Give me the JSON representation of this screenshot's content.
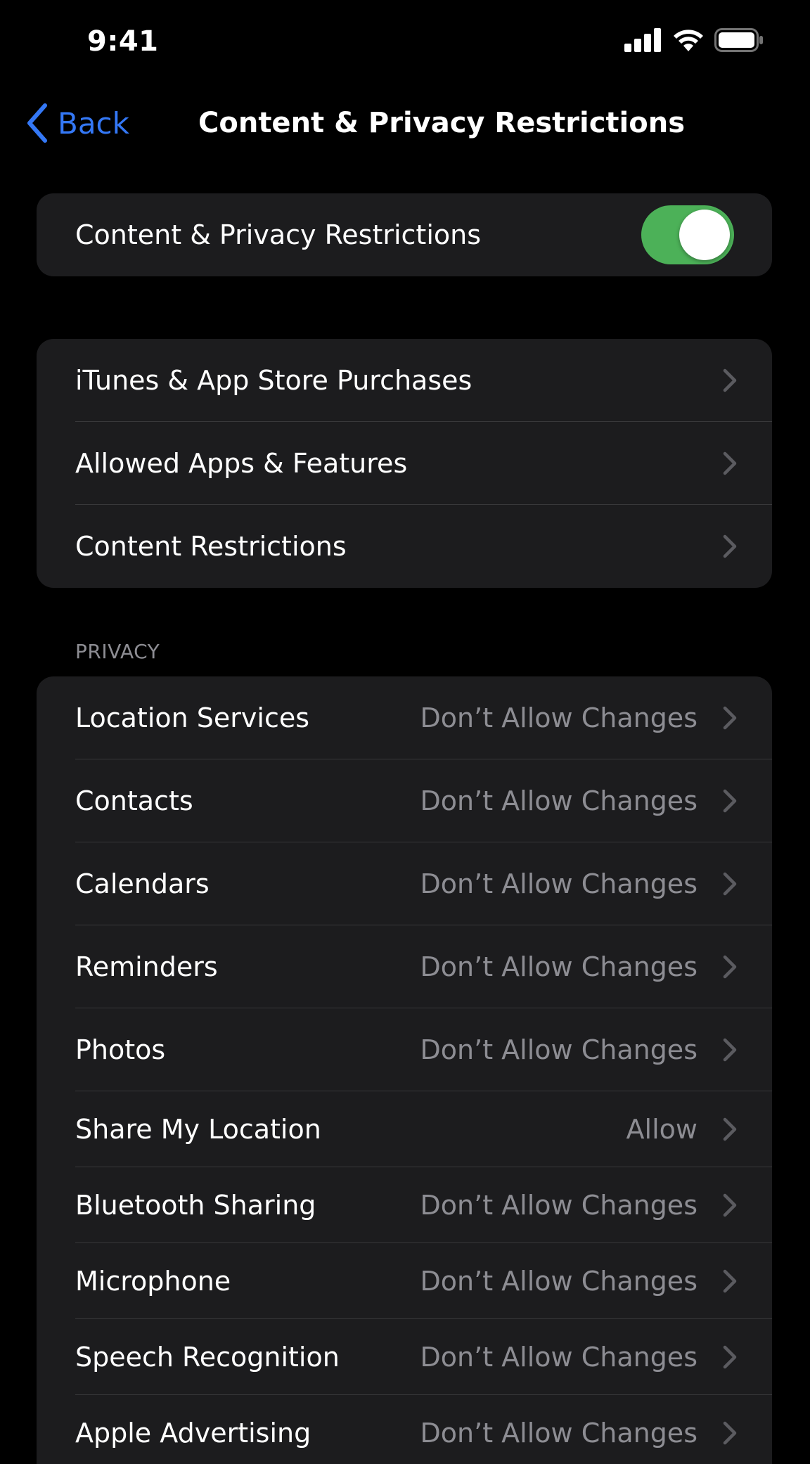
{
  "status_bar": {
    "time": "9:41",
    "icons": [
      "cellular-signal-icon",
      "wifi-icon",
      "battery-icon"
    ]
  },
  "nav": {
    "back_label": "Back",
    "title": "Content & Privacy Restrictions"
  },
  "main_toggle": {
    "label": "Content & Privacy Restrictions",
    "on": true
  },
  "store_group": {
    "items": [
      {
        "label": "iTunes & App Store Purchases"
      },
      {
        "label": "Allowed Apps & Features"
      },
      {
        "label": "Content Restrictions"
      }
    ]
  },
  "privacy": {
    "header": "PRIVACY",
    "items": [
      {
        "label": "Location Services",
        "value": "Don’t Allow Changes"
      },
      {
        "label": "Contacts",
        "value": "Don’t Allow Changes"
      },
      {
        "label": "Calendars",
        "value": "Don’t Allow Changes"
      },
      {
        "label": "Reminders",
        "value": "Don’t Allow Changes"
      },
      {
        "label": "Photos",
        "value": "Don’t Allow Changes"
      },
      {
        "label": "Share My Location",
        "value": "Allow"
      },
      {
        "label": "Bluetooth Sharing",
        "value": "Don’t Allow Changes"
      },
      {
        "label": "Microphone",
        "value": "Don’t Allow Changes"
      },
      {
        "label": "Speech Recognition",
        "value": "Don’t Allow Changes"
      },
      {
        "label": "Apple Advertising",
        "value": "Don’t Allow Changes"
      }
    ]
  },
  "colors": {
    "background": "#000000",
    "cell": "#1c1c1e",
    "accent": "#3478f6",
    "toggle_on": "#4cb158",
    "secondary_text": "#8d8d93",
    "separator": "#38383a"
  }
}
